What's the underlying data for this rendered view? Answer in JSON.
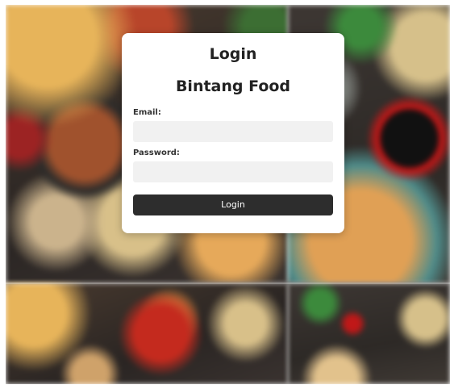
{
  "login_card": {
    "title": "Login",
    "subtitle": "Bintang Food",
    "email_label": "Email:",
    "email_value": "",
    "password_label": "Password:",
    "password_value": "",
    "submit_label": "Login"
  },
  "colors": {
    "card_background": "#ffffff",
    "field_background": "#f1f1f1",
    "button_background": "#2d2d2d",
    "button_text": "#ffffff"
  }
}
